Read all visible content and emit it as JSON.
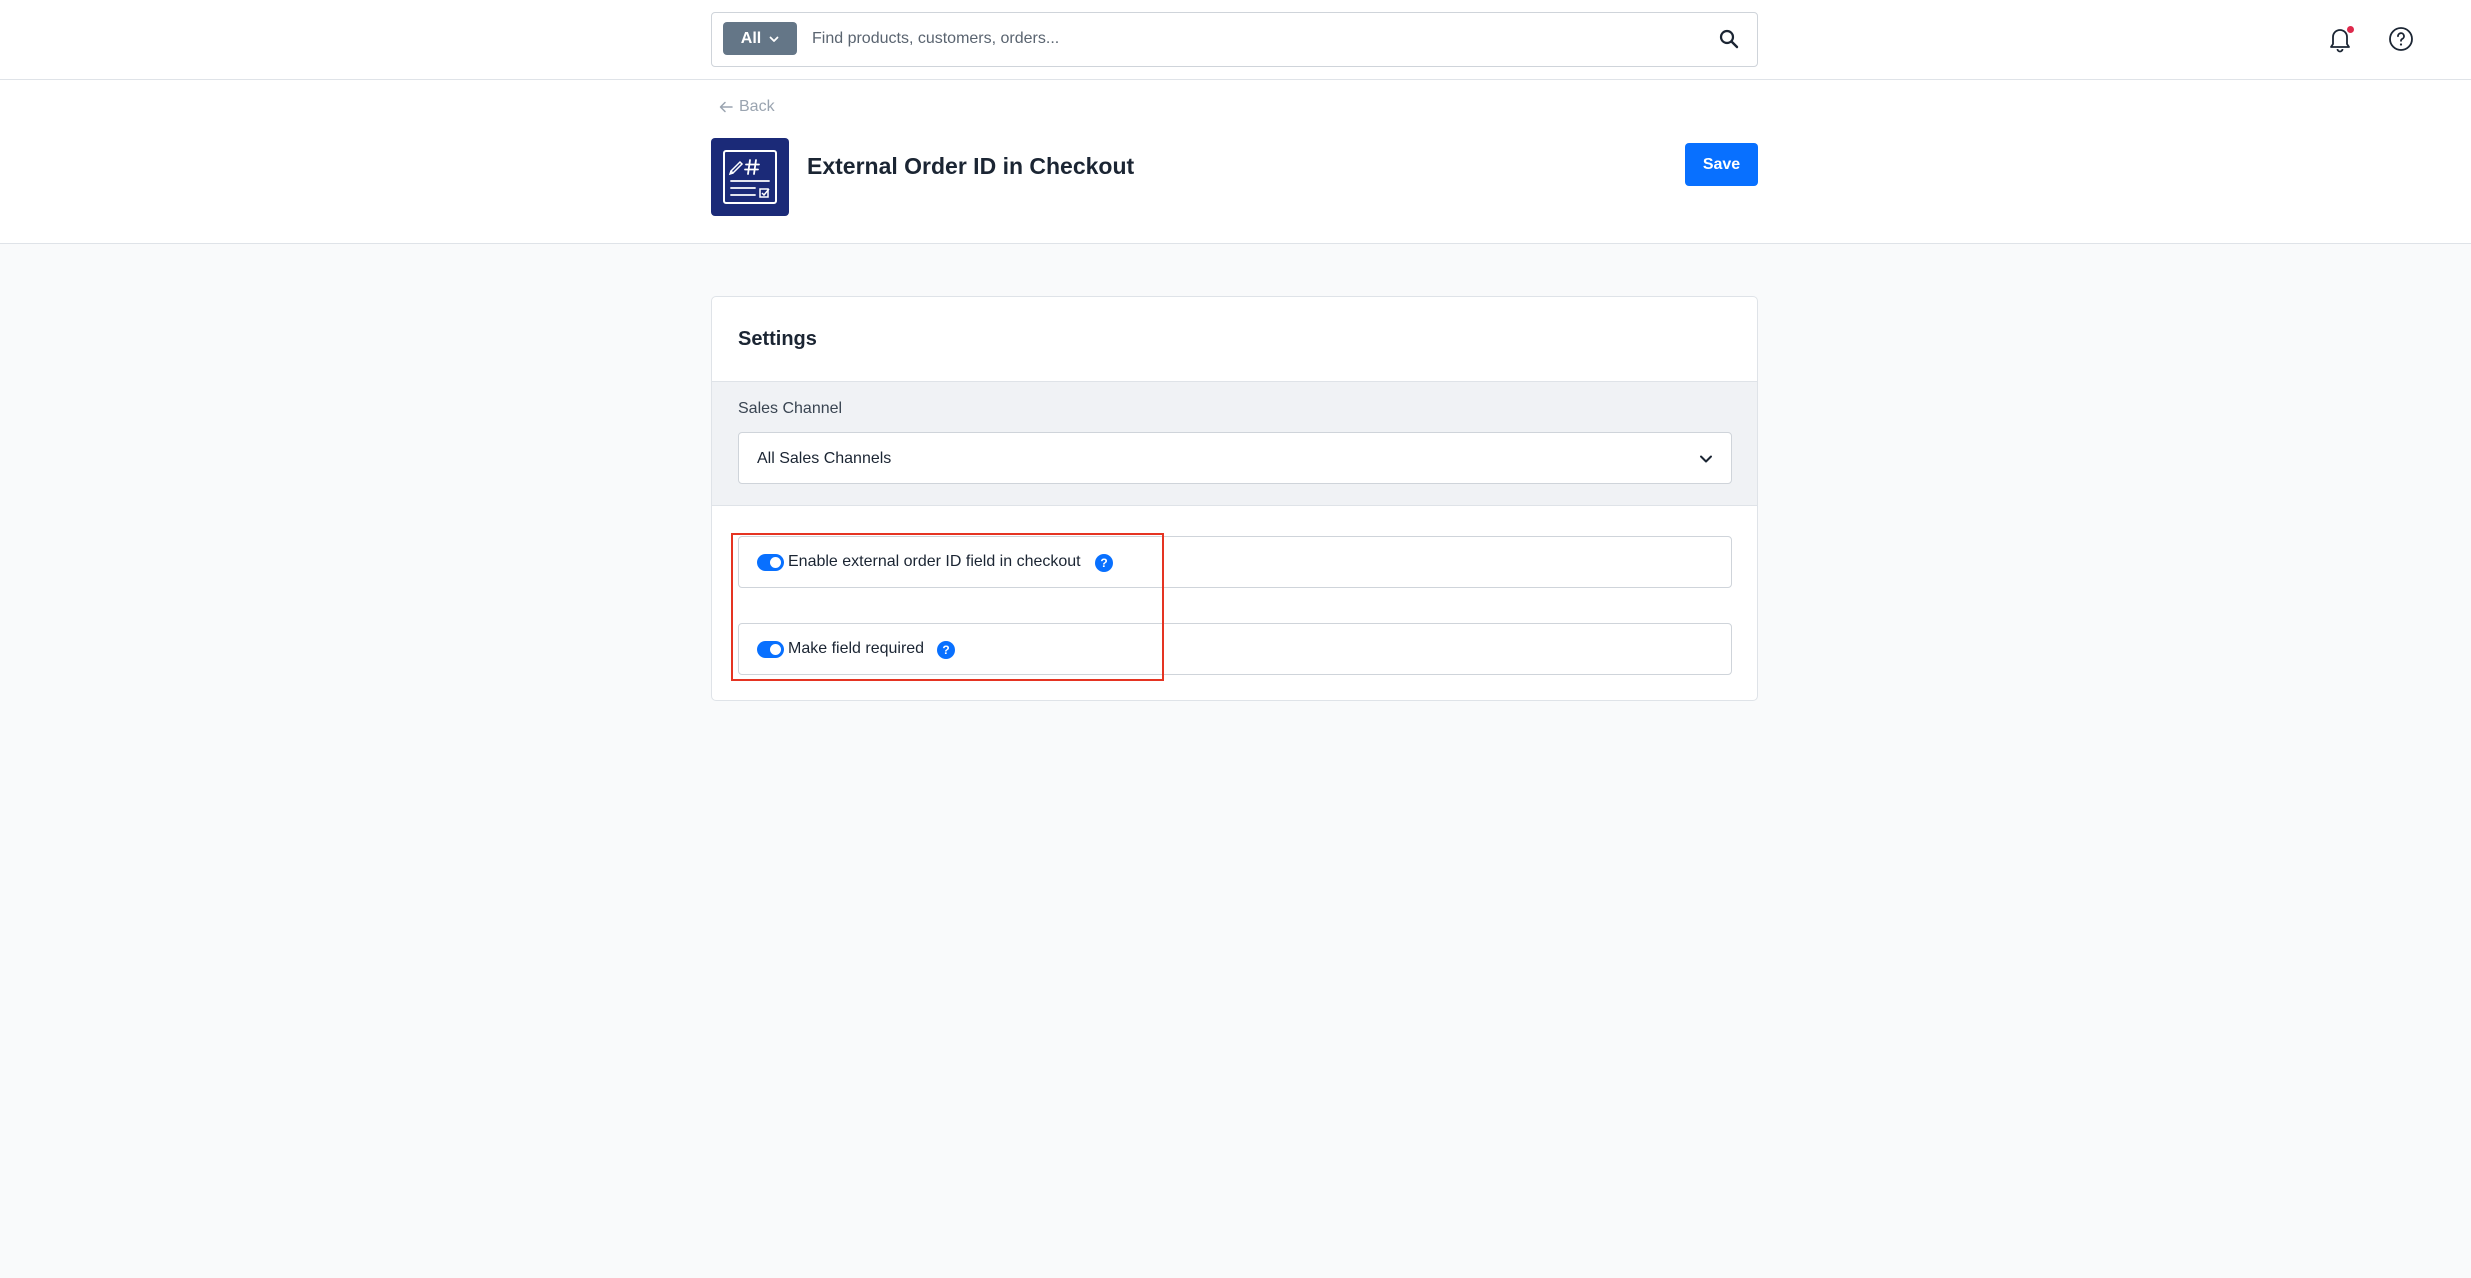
{
  "search": {
    "filter_label": "All",
    "placeholder": "Find products, customers, orders...",
    "value": ""
  },
  "header": {
    "back_label": "Back",
    "title": "External Order ID in Checkout",
    "save_label": "Save"
  },
  "settings": {
    "title": "Settings",
    "sales_channel_label": "Sales Channel",
    "sales_channel_value": "All Sales Channels",
    "toggles": [
      {
        "label": "Enable external order ID field in checkout",
        "enabled": true,
        "help": "?"
      },
      {
        "label": "Make field required",
        "enabled": true,
        "help": "?"
      }
    ]
  },
  "colors": {
    "primary": "#0870ff",
    "app_icon_bg": "#1b2a78",
    "highlight": "#e53422",
    "notification_dot": "#de294c"
  },
  "icons": [
    "search-icon",
    "bell-icon",
    "help-circle-icon",
    "arrow-left-icon",
    "chevron-down-icon",
    "app-order-id-icon",
    "info-icon"
  ]
}
